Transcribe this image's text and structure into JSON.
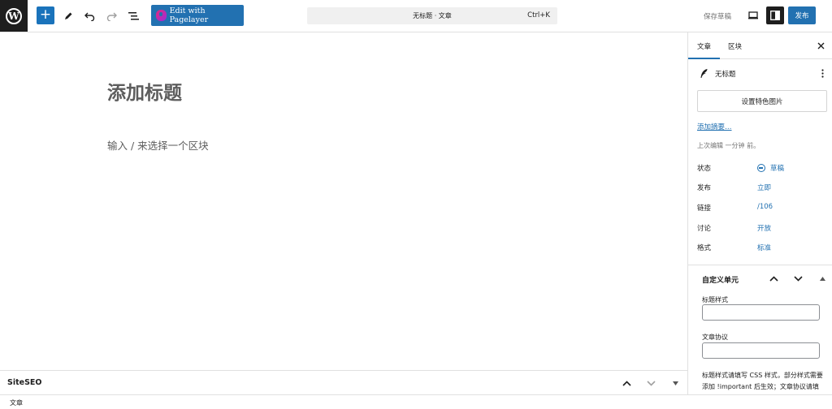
{
  "toolbar": {
    "add_block": "+",
    "pagelayer_label": "Edit with Pagelayer",
    "command_title": "无标题 · 文章",
    "command_shortcut": "Ctrl+K",
    "save_draft": "保存草稿",
    "publish": "发布",
    "accent_color": "#2271b1"
  },
  "canvas": {
    "title_placeholder": "添加标题",
    "block_placeholder": "输入 / 来选择一个区块"
  },
  "seo_box": {
    "label": "SiteSEO"
  },
  "footer": {
    "breadcrumb": "文章"
  },
  "sidebar": {
    "tabs": [
      {
        "label": "文章",
        "active": true
      },
      {
        "label": "区块",
        "active": false
      }
    ],
    "post_name": "无标题",
    "featured_image_button": "设置特色图片",
    "excerpt_link": "添加摘要…",
    "last_edited": "上次编辑 一分钟 前。",
    "meta": [
      {
        "key": "状态",
        "value": "草稿"
      },
      {
        "key": "发布",
        "value": "立即"
      },
      {
        "key": "链接",
        "value": "/106"
      },
      {
        "key": "讨论",
        "value": "开放"
      },
      {
        "key": "格式",
        "value": "标准"
      }
    ],
    "custom_unit": {
      "title": "自定义单元",
      "field1_label": "标题样式",
      "field1_value": "",
      "field2_label": "文章协议",
      "field2_value": "",
      "help_text": "标题样式请填写 CSS 样式，部分样式需要添加 !important 后生效；文章协议请填写版权说明..."
    }
  }
}
